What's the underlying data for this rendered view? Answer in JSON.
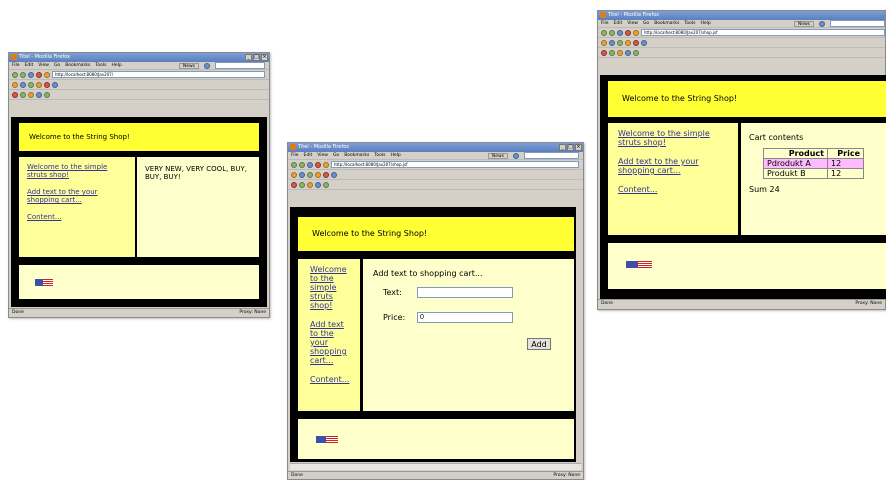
{
  "windows": [
    {
      "title": "Titel - Mozilla Firefox",
      "menu": [
        "File",
        "Edit",
        "View",
        "Go",
        "Bookmarks",
        "Tools",
        "Help"
      ],
      "url": "http://localhost:8080/Jav207/",
      "search": "",
      "news_label": "News",
      "header": "Welcome to the String Shop!",
      "links": [
        "Welcome to the simple struts shop!",
        "Add text to the your shopping cart...",
        "Content..."
      ],
      "main_text": "VERY NEW, VERY COOL, BUY, BUY, BUY!",
      "status_left": "Done",
      "status_right": "Proxy: None"
    },
    {
      "title": "Titel - Mozilla Firefox",
      "menu": [
        "File",
        "Edit",
        "View",
        "Go",
        "Bookmarks",
        "Tools",
        "Help"
      ],
      "url": "http://localhost:8080/Jav207/shop.jsf",
      "search": "",
      "news_label": "News",
      "header": "Welcome to the String Shop!",
      "links": [
        "Welcome to the simple struts shop!",
        "Add text to the your shopping cart...",
        "Content..."
      ],
      "form_title": "Add text to shopping cart...",
      "text_label": "Text:",
      "text_value": "",
      "price_label": "Price:",
      "price_value": "0",
      "add_label": "Add",
      "status_left": "Done",
      "status_right": "Proxy: None"
    },
    {
      "title": "Titel - Mozilla Firefox",
      "menu": [
        "File",
        "Edit",
        "View",
        "Go",
        "Bookmarks",
        "Tools",
        "Help"
      ],
      "url": "http://localhost:8080/Jav207/shop.jsf",
      "search": "",
      "news_label": "News",
      "header": "Welcome to the String Shop!",
      "links": [
        "Welcome to the simple struts shop!",
        "Add text to the your shopping cart...",
        "Content..."
      ],
      "cart_title": "Cart contents",
      "cart_headers": [
        "Product",
        "Price"
      ],
      "cart_rows": [
        [
          "Pdrodukt A",
          "12"
        ],
        [
          "Produkt B",
          "12"
        ]
      ],
      "sum_text": "Sum 24",
      "status_left": "Done",
      "status_right": "Proxy: None"
    }
  ],
  "colors": {
    "header": "#ffff33",
    "left": "#ffff99",
    "right": "#ffffcc",
    "border": "#000000",
    "link": "#333399"
  }
}
